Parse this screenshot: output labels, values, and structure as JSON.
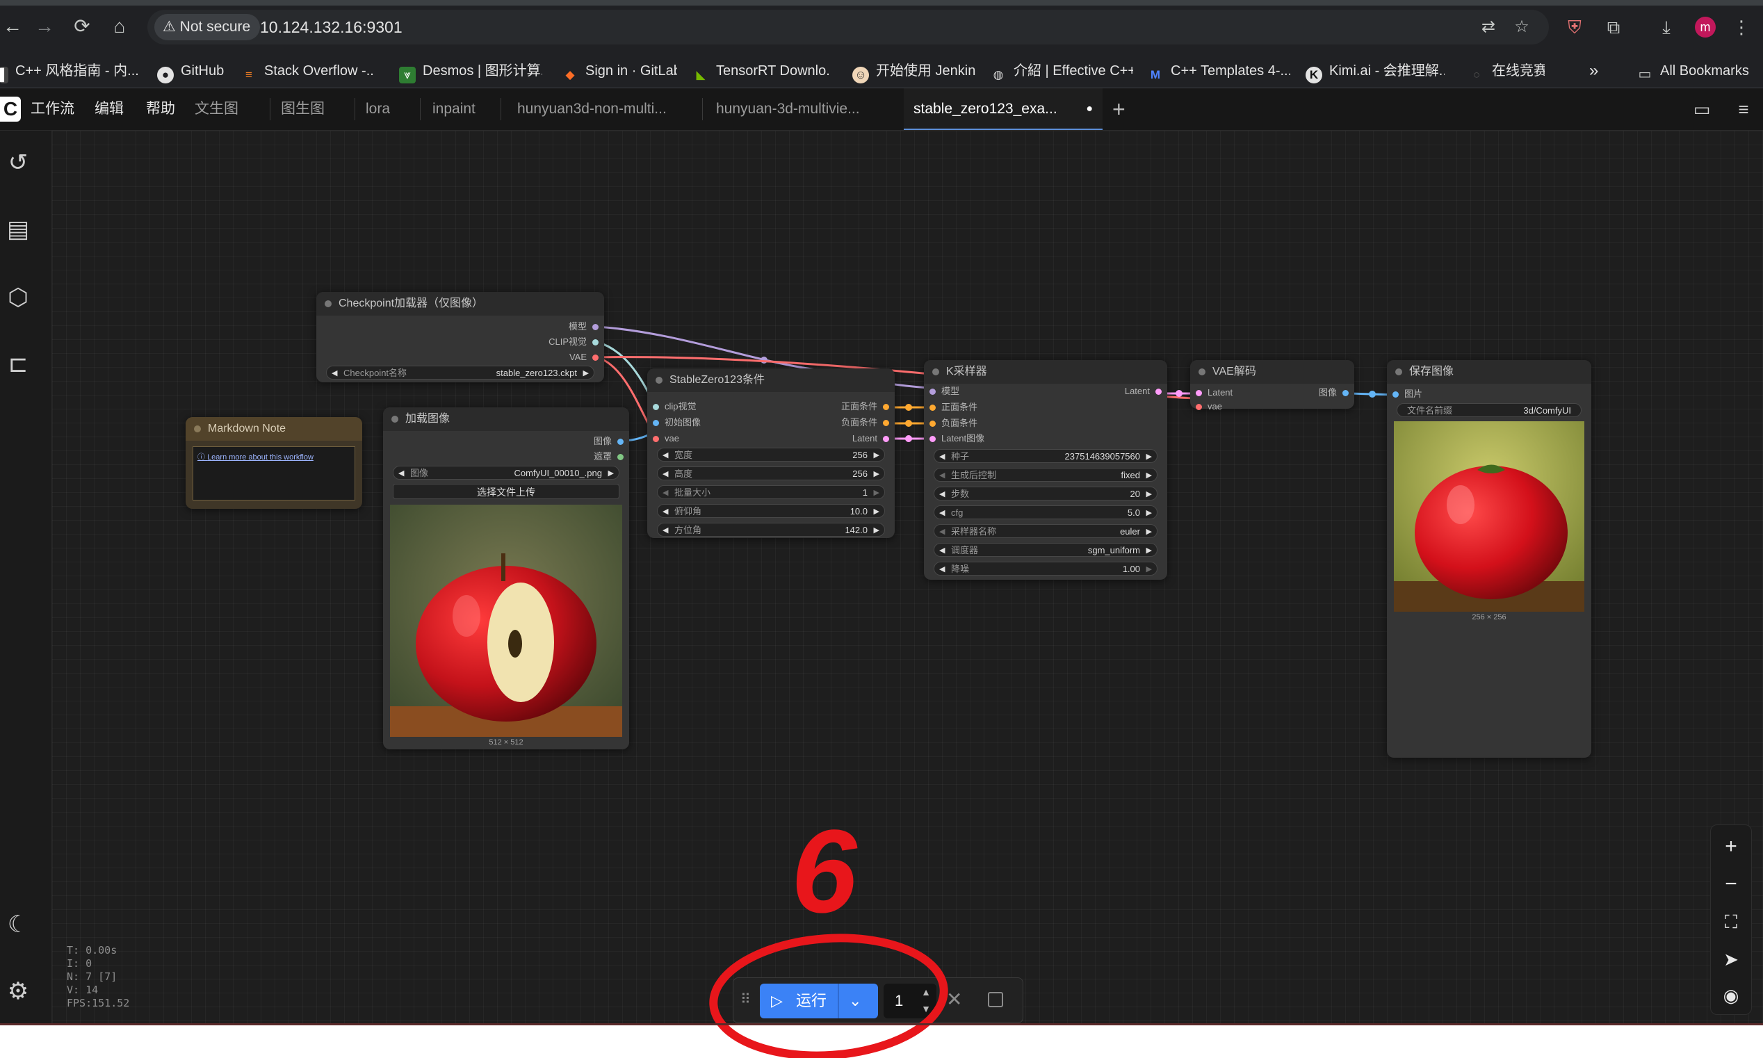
{
  "browser": {
    "secure_label": "Not secure",
    "url": "10.124.132.16:9301",
    "avatar_letter": "m",
    "bookmarks": [
      "C++ 风格指南 - 内...",
      "GitHub",
      "Stack Overflow -...",
      "Desmos | 图形计算...",
      "Sign in · GitLab",
      "TensorRT Downlo...",
      "开始使用 Jenkins",
      "介紹 | Effective C++",
      "C++ Templates 4-...",
      "Kimi.ai - 会推理解...",
      "在线竞赛"
    ],
    "more_bookmarks": "»",
    "all_bookmarks": "All Bookmarks"
  },
  "menu": {
    "logo": "C",
    "items": [
      "工作流",
      "编辑",
      "帮助"
    ],
    "tabs": [
      "文生图",
      "图生图",
      "lora",
      "inpaint",
      "hunyuan3d-non-multi...",
      "hunyuan-3d-multivie...",
      "stable_zero123_exa..."
    ],
    "active_tab_unsaved": "●",
    "add_tab": "+"
  },
  "nodes": {
    "checkpoint": {
      "title": "Checkpoint加载器（仅图像）",
      "outputs": [
        "模型",
        "CLIP视觉",
        "VAE"
      ],
      "widget_label": "Checkpoint名称",
      "widget_value": "stable_zero123.ckpt"
    },
    "markdown": {
      "title": "Markdown Note",
      "link": "Learn more about this workflow"
    },
    "load_image": {
      "title": "加载图像",
      "outputs": [
        "图像",
        "遮罩"
      ],
      "widget_label": "图像",
      "widget_value": "ComfyUI_00010_.png",
      "upload_label": "选择文件上传",
      "caption": "512 × 512"
    },
    "zero123": {
      "title": "StableZero123条件",
      "inputs": [
        "clip视觉",
        "初始图像",
        "vae"
      ],
      "outputs": [
        "正面条件",
        "负面条件",
        "Latent"
      ],
      "widgets": [
        {
          "label": "宽度",
          "value": "256"
        },
        {
          "label": "高度",
          "value": "256"
        },
        {
          "label": "批量大小",
          "value": "1"
        },
        {
          "label": "俯仰角",
          "value": "10.0"
        },
        {
          "label": "方位角",
          "value": "142.0"
        }
      ]
    },
    "ksampler": {
      "title": "K采样器",
      "inputs": [
        "模型",
        "正面条件",
        "负面条件",
        "Latent图像"
      ],
      "outputs": [
        "Latent"
      ],
      "widgets": [
        {
          "label": "种子",
          "value": "237514639057560"
        },
        {
          "label": "生成后控制",
          "value": "fixed"
        },
        {
          "label": "步数",
          "value": "20"
        },
        {
          "label": "cfg",
          "value": "5.0"
        },
        {
          "label": "采样器名称",
          "value": "euler"
        },
        {
          "label": "调度器",
          "value": "sgm_uniform"
        },
        {
          "label": "降噪",
          "value": "1.00"
        }
      ]
    },
    "vae_decode": {
      "title": "VAE解码",
      "inputs": [
        "Latent",
        "vae"
      ],
      "outputs": [
        "图像"
      ]
    },
    "save_image": {
      "title": "保存图像",
      "inputs": [
        "图片"
      ],
      "widget_label": "文件名前缀",
      "widget_value": "3d/ComfyUI",
      "caption": "256 × 256"
    }
  },
  "stats": [
    "T: 0.00s",
    "I: 0",
    "N: 7 [7]",
    "V: 14",
    "FPS:151.52"
  ],
  "runbar": {
    "run_label": "运行",
    "batch_count": "1"
  },
  "annotation": {
    "number": "6",
    "color": "#e8161b"
  },
  "colors": {
    "run_button": "#3b82f6",
    "link_model": "#b39ddb",
    "link_clip_vision": "#a8dadc",
    "link_vae": "#ff6e6e",
    "link_image": "#64b5f6",
    "link_mask": "#81c784",
    "link_conditioning": "#ffa931",
    "link_latent": "#ff9cf9"
  }
}
